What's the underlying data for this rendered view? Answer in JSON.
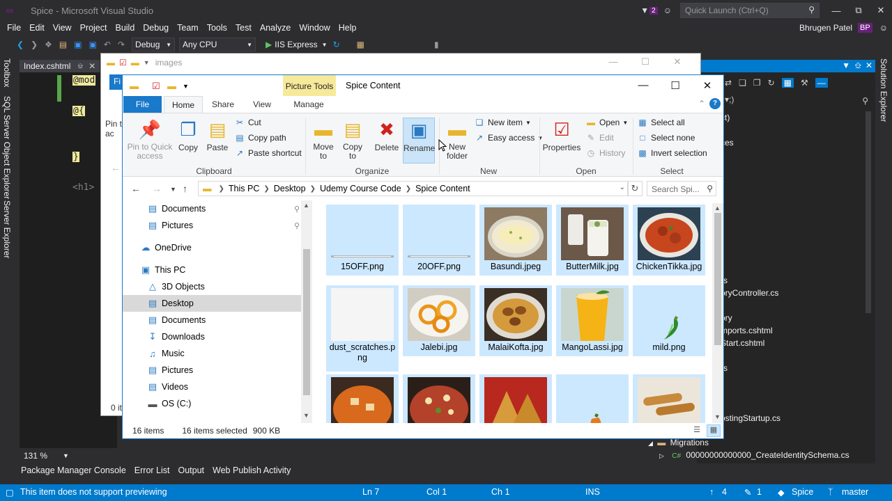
{
  "vs": {
    "title": "Spice - Microsoft Visual Studio",
    "notifications_count": "2",
    "quick_launch_placeholder": "Quick Launch (Ctrl+Q)",
    "menu": [
      "File",
      "Edit",
      "View",
      "Project",
      "Build",
      "Debug",
      "Team",
      "Tools",
      "Test",
      "Analyze",
      "Window",
      "Help"
    ],
    "user_name": "Bhrugen Patel",
    "user_initials": "BP",
    "config": "Debug",
    "platform": "Any CPU",
    "run_target": "IIS Express",
    "left_rail": [
      "Toolbox",
      "SQL Server Object Explorer",
      "Server Explorer"
    ],
    "right_rail": "Solution Explorer",
    "doc_tab": "Index.cshtml",
    "code": [
      "@mod",
      "@{",
      "}",
      "<h1>"
    ],
    "zoom": "131 %",
    "bottom_tabs": [
      "Package Manager Console",
      "Error List",
      "Output",
      "Web Publish Activity"
    ],
    "solution_items": [
      "ct)",
      "ces",
      "rs",
      "oryController.cs",
      "ory",
      "mports.cshtml",
      "Start.cshtml",
      "rs",
      "ostingStartup.cs"
    ],
    "migrations_folder": "Migrations",
    "migration_file": "00000000000000_CreateIdentitySchema.cs",
    "status": {
      "message": "This item does not support previewing",
      "ln": "Ln 7",
      "col": "Col 1",
      "ch": "Ch 1",
      "mode": "INS",
      "up_count": "4",
      "edit_count": "1",
      "repo": "Spice",
      "branch": "master"
    }
  },
  "bg_explorer": {
    "title": "images",
    "file_tab": "Fi",
    "pin_text": "Pin t\nac",
    "items_text": "0 it"
  },
  "explorer": {
    "title": "Spice Content",
    "context_tab": "Picture Tools",
    "tabs": {
      "file": "File",
      "home": "Home",
      "share": "Share",
      "view": "View",
      "manage": "Manage"
    },
    "ribbon": {
      "clipboard": {
        "label": "Clipboard",
        "pin": "Pin to Quick\naccess",
        "copy": "Copy",
        "paste": "Paste",
        "cut": "Cut",
        "copy_path": "Copy path",
        "paste_shortcut": "Paste shortcut"
      },
      "organize": {
        "label": "Organize",
        "move_to": "Move\nto",
        "copy_to": "Copy\nto",
        "delete": "Delete",
        "rename": "Rename"
      },
      "new": {
        "label": "New",
        "new_folder": "New\nfolder",
        "new_item": "New item",
        "easy_access": "Easy access"
      },
      "open": {
        "label": "Open",
        "properties": "Properties",
        "open": "Open",
        "edit": "Edit",
        "history": "History"
      },
      "select": {
        "label": "Select",
        "select_all": "Select all",
        "select_none": "Select none",
        "invert": "Invert selection"
      }
    },
    "breadcrumb": [
      "This PC",
      "Desktop",
      "Udemy Course Code",
      "Spice Content"
    ],
    "search_placeholder": "Search Spi...",
    "nav": [
      {
        "label": "Documents",
        "icon": "documents-folder-icon",
        "pinned": true
      },
      {
        "label": "Pictures",
        "icon": "pictures-folder-icon",
        "pinned": true
      },
      {
        "label": "OneDrive",
        "icon": "onedrive-icon"
      },
      {
        "label": "This PC",
        "icon": "this-pc-icon"
      },
      {
        "label": "3D Objects",
        "icon": "3d-objects-icon"
      },
      {
        "label": "Desktop",
        "icon": "desktop-folder-icon",
        "selected": true
      },
      {
        "label": "Documents",
        "icon": "documents-folder-icon"
      },
      {
        "label": "Downloads",
        "icon": "downloads-folder-icon"
      },
      {
        "label": "Music",
        "icon": "music-folder-icon"
      },
      {
        "label": "Pictures",
        "icon": "pictures-folder-icon"
      },
      {
        "label": "Videos",
        "icon": "videos-folder-icon"
      },
      {
        "label": "OS (C:)",
        "icon": "drive-icon"
      }
    ],
    "files": [
      {
        "name": "15OFF.png",
        "kind": "banner"
      },
      {
        "name": "20OFF.png",
        "kind": "banner"
      },
      {
        "name": "Basundi.jpeg",
        "kind": "basundi"
      },
      {
        "name": "ButterMilk.jpg",
        "kind": "buttermilk"
      },
      {
        "name": "ChickenTikka.jpg",
        "kind": "tikka"
      },
      {
        "name": "dust_scratches.png",
        "kind": "blank"
      },
      {
        "name": "Jalebi.jpg",
        "kind": "jalebi"
      },
      {
        "name": "MalaiKofta.jpg",
        "kind": "kofta"
      },
      {
        "name": "MangoLassi.jpg",
        "kind": "lassi"
      },
      {
        "name": "mild.png",
        "kind": "chili"
      },
      {
        "name": "",
        "kind": "paneer"
      },
      {
        "name": "",
        "kind": "chaat"
      },
      {
        "name": "",
        "kind": "samosa"
      },
      {
        "name": "",
        "kind": "spicy"
      },
      {
        "name": "",
        "kind": "rolls"
      }
    ],
    "status": {
      "count": "16 items",
      "selected": "16 items selected",
      "size": "900 KB"
    }
  }
}
